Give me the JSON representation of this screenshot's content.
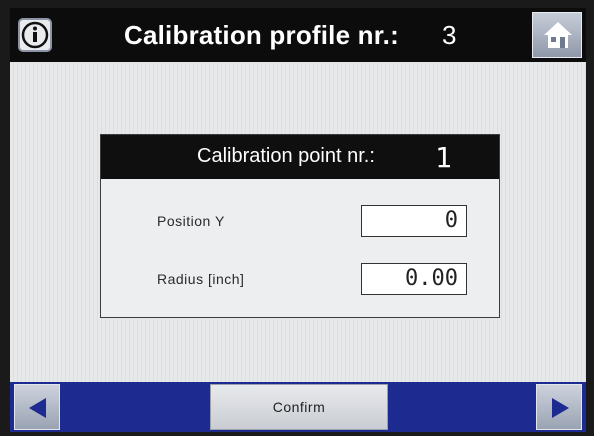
{
  "header": {
    "title": "Calibration profile nr.:",
    "profile_number": "3"
  },
  "panel": {
    "title": "Calibration point nr.:",
    "point_number": "1",
    "fields": [
      {
        "label": "Position Y",
        "value": "0"
      },
      {
        "label": "Radius [inch]",
        "value": "0.00"
      }
    ]
  },
  "footer": {
    "confirm_label": "Confirm"
  },
  "icons": {
    "info": "info-icon",
    "home": "home-icon",
    "prev": "arrow-left-icon",
    "next": "arrow-right-icon"
  },
  "colors": {
    "header_bg": "#0c0c0c",
    "footer_bg": "#1d2a8f",
    "screen_bg": "#dddfe2"
  }
}
